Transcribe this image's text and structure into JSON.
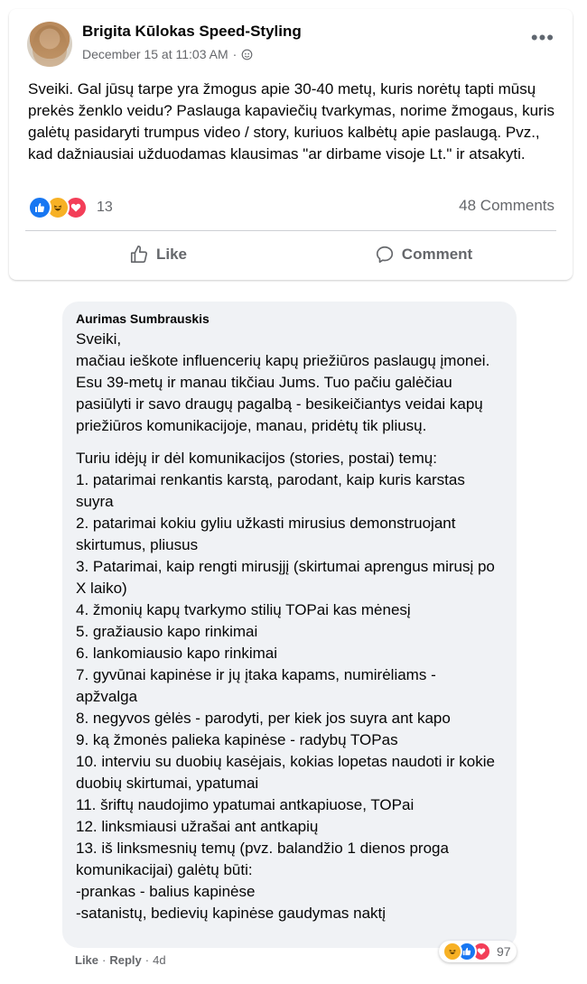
{
  "post": {
    "author": "Brigita Kūlokas Speed-Styling",
    "timestamp": "December 15 at 11:03 AM",
    "separator": "·",
    "text": "Sveiki. Gal jūsų tarpe yra žmogus apie 30-40 metų, kuris norėtų tapti mūsų prekės ženklo veidu? Paslauga kapaviečių tvarkymas, norime žmogaus, kuris galėtų pasidaryti trumpus video / story, kuriuos kalbėtų apie paslaugą. Pvz., kad dažniausiai užduodamas klausimas \"ar dirbame visoje Lt.\" ir atsakyti.",
    "reaction_count": "13",
    "comments_count": "48 Comments",
    "reactions": [
      "like-icon",
      "haha-icon",
      "love-icon"
    ]
  },
  "actions": {
    "like_label": "Like",
    "comment_label": "Comment"
  },
  "comment": {
    "author": "Aurimas Sumbrauskis",
    "paragraph1": [
      "Sveiki,",
      "mačiau ieškote influencerių kapų priežiūros paslaugų įmonei.",
      "Esu 39-metų ir manau tikčiau Jums. Tuo pačiu galėčiau pasiūlyti ir savo draugų pagalbą - besikeičiantys veidai kapų priežiūros komunikacijoje, manau, pridėtų tik pliusų."
    ],
    "paragraph2": [
      "Turiu idėjų ir dėl komunikacijos (stories, postai) temų:",
      "1. patarimai renkantis karstą, parodant, kaip kuris karstas suyra",
      "2. patarimai kokiu gyliu užkasti mirusius demonstruojant skirtumus, pliusus",
      "3. Patarimai, kaip rengti mirusįjį (skirtumai aprengus mirusį po X laiko)",
      "4. žmonių kapų tvarkymo stilių TOPai kas mėnesį",
      "5. gražiausio kapo rinkimai",
      "6. lankomiausio kapo rinkimai",
      "7. gyvūnai kapinėse ir jų įtaka kapams, numirėliams - apžvalga",
      "8. negyvos gėlės - parodyti, per kiek jos suyra ant kapo",
      "9. ką žmonės palieka kapinėse - radybų TOPas",
      "10. interviu su duobių kasėjais, kokias lopetas naudoti ir kokie duobių skirtumai, ypatumai",
      "11. šriftų naudojimo ypatumai antkapiuose, TOPai",
      "12. linksmiausi užrašai ant antkapių",
      "13. iš linksmesnių temų (pvz. balandžio 1 dienos proga komunikacijai) galėtų būti:",
      "-prankas - balius kapinėse",
      "-satanistų, bedievių kapinėse gaudymas naktį"
    ],
    "footer": {
      "like": "Like",
      "dot": "·",
      "reply": "Reply",
      "age": "4d"
    },
    "reaction_count": "97",
    "reactions": [
      "haha-icon",
      "like-icon",
      "love-icon"
    ]
  },
  "colors": {
    "like": "#1877f2",
    "haha": "#f7b125",
    "love": "#f33e58",
    "bubble": "#f0f2f5",
    "secondary_text": "#65676b"
  }
}
